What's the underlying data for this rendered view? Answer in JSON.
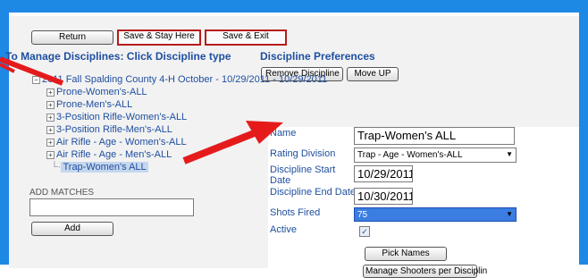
{
  "toolbar": {
    "return_label": "Return",
    "save_stay_label": "Save & Stay Here",
    "save_exit_label": "Save & Exit"
  },
  "left": {
    "heading": "To Manage Disciplines: Click Discipline type",
    "tree_root": "2011 Fall Spalding County 4-H October - 10/29/2011 - 10/29/2011",
    "tree_items": [
      "Prone-Women's-ALL",
      "Prone-Men's-ALL",
      "3-Position Rifle-Women's-ALL",
      "3-Position Rifle-Men's-ALL",
      "Air Rifle - Age - Women's-ALL",
      "Air Rifle - Age - Men's-ALL",
      "Trap-Women's ALL"
    ],
    "add_matches_label": "ADD MATCHES",
    "add_matches_value": "",
    "add_label": "Add"
  },
  "right": {
    "heading": "Discipline Preferences",
    "remove_label": "Remove Discipline",
    "move_up_label": "Move UP"
  },
  "form": {
    "name_label": "Name",
    "name_value": "Trap-Women's ALL",
    "rating_label": "Rating Division",
    "rating_value": "Trap - Age - Women's-ALL",
    "start_label": "Discipline Start Date",
    "start_value": "10/29/2011",
    "end_label": "Discipline End Date",
    "end_value": "10/30/2011",
    "shots_label": "Shots Fired",
    "shots_value": "75",
    "active_label": "Active",
    "active_checked": true,
    "pick_names_label": "Pick Names",
    "manage_shooters_label": "Manage Shooters per Disciplin"
  },
  "colors": {
    "frame": "#1e88e5",
    "annotation_arrow": "#e51b1b",
    "link_text": "#1f4fa0"
  }
}
